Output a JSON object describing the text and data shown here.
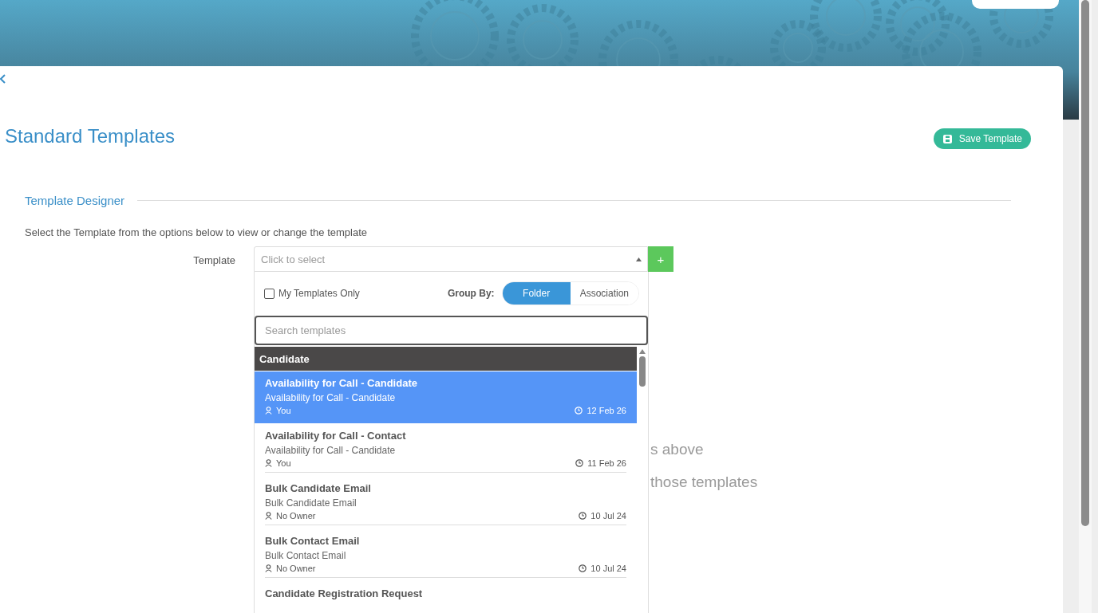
{
  "page": {
    "title": "Standard Templates",
    "save_button": "Save Template"
  },
  "section": {
    "title": "Template Designer",
    "instruction": "Select the Template from the options below to view or change the template"
  },
  "template_field": {
    "label": "Template",
    "placeholder": "Click to select",
    "add_button": "+"
  },
  "background_text": [
    "s above",
    "those templates"
  ],
  "dropdown": {
    "my_templates_only": {
      "label": "My Templates Only",
      "checked": false
    },
    "group_by": {
      "label": "Group By:",
      "options": [
        {
          "label": "Folder",
          "selected": true
        },
        {
          "label": "Association",
          "selected": false
        }
      ]
    },
    "search": {
      "placeholder": "Search templates"
    },
    "group": "Candidate",
    "items": [
      {
        "title": "Availability for Call - Candidate",
        "subtitle": "Availability for Call - Candidate",
        "owner": "You",
        "date": "12 Feb 26",
        "selected": true
      },
      {
        "title": "Availability for Call - Contact",
        "subtitle": "Availability for Call - Candidate",
        "owner": "You",
        "date": "11 Feb 26",
        "selected": false
      },
      {
        "title": "Bulk Candidate Email",
        "subtitle": "Bulk Candidate Email",
        "owner": "No Owner",
        "date": "10 Jul 24",
        "selected": false
      },
      {
        "title": "Bulk Contact Email",
        "subtitle": "Bulk Contact Email",
        "owner": "No Owner",
        "date": "10 Jul 24",
        "selected": false
      },
      {
        "title": "Candidate Registration Request",
        "selected": false
      }
    ]
  }
}
